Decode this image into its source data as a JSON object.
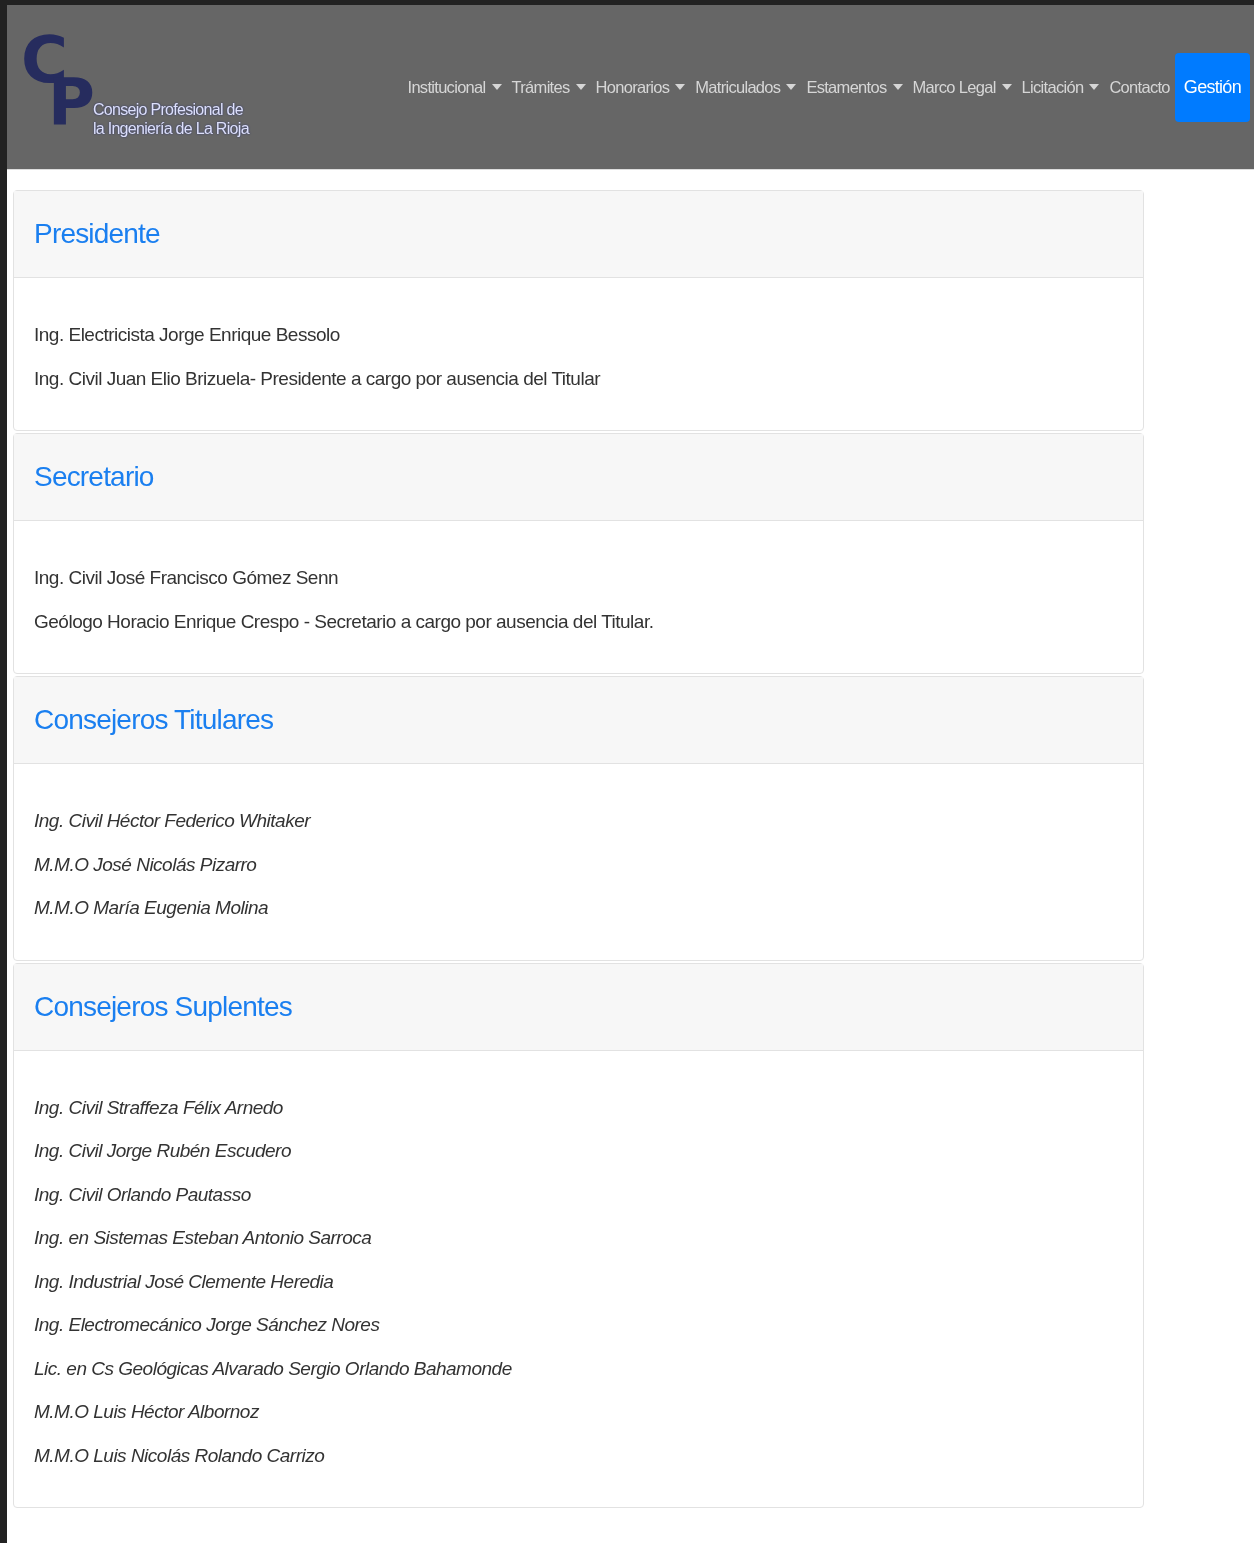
{
  "logo": {
    "letters": [
      "C",
      "P"
    ],
    "name_lines": [
      "Consejo Profesional de",
      "la Ingeniería de La Rioja"
    ]
  },
  "nav": [
    {
      "label": "Institucional",
      "dropdown": true,
      "selected": false
    },
    {
      "label": "Trámites",
      "dropdown": true,
      "selected": false
    },
    {
      "label": "Honorarios",
      "dropdown": true,
      "selected": false
    },
    {
      "label": "Matriculados",
      "dropdown": true,
      "selected": false
    },
    {
      "label": "Estamentos",
      "dropdown": true,
      "selected": false
    },
    {
      "label": "Marco Legal",
      "dropdown": true,
      "selected": false
    },
    {
      "label": "Licitación",
      "dropdown": true,
      "selected": false
    },
    {
      "label": "Contacto",
      "dropdown": false,
      "selected": false
    },
    {
      "label": "Gestión",
      "dropdown": false,
      "selected": true
    }
  ],
  "sections": [
    {
      "title": "Presidente",
      "kind": "plain",
      "members": [
        "Ing. Electricista Jorge Enrique Bessolo",
        "Ing. Civil Juan Elio Brizuela- Presidente a cargo por ausencia del Titular"
      ]
    },
    {
      "title": "Secretario",
      "kind": "plain",
      "members": [
        "Ing. Civil José Francisco Gómez Senn",
        "Geólogo Horacio Enrique Crespo - Secretario a cargo por ausencia del Titular."
      ]
    },
    {
      "title": "Consejeros Titulares",
      "kind": "italic",
      "members": [
        "Ing. Civil Héctor Federico Whitaker",
        "M.M.O José Nicolás Pizarro",
        "M.M.O María Eugenia Molina"
      ]
    },
    {
      "title": "Consejeros Suplentes",
      "kind": "italic",
      "members": [
        "Ing. Civil Straffeza Félix Arnedo",
        "Ing. Civil Jorge Rubén Escudero",
        "Ing. Civil Orlando Pautasso",
        "Ing. en Sistemas Esteban Antonio Sarroca",
        "Ing. Industrial José Clemente Heredia",
        "Ing. Electromecánico Jorge Sánchez Nores",
        "Lic. en Cs Geológicas Alvarado Sergio Orlando Bahamonde",
        "M.M.O Luis Héctor Albornoz",
        "M.M.O Luis Nicolás Rolando Carrizo"
      ]
    }
  ]
}
